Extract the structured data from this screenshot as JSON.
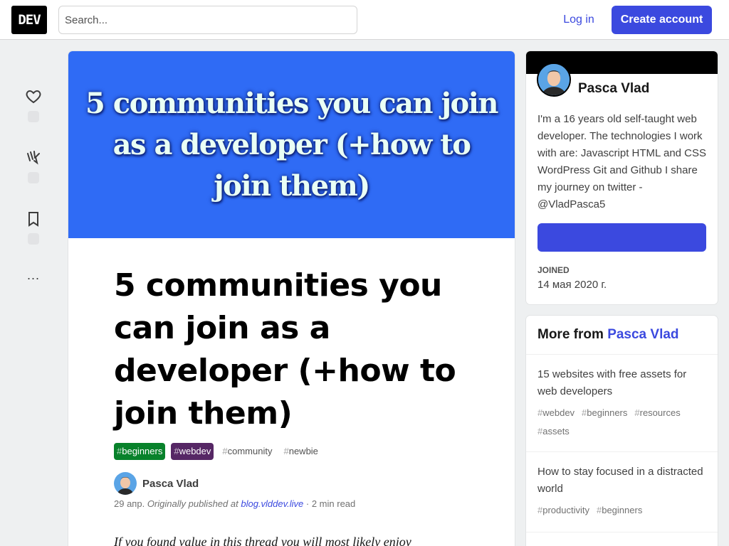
{
  "header": {
    "logo": "DEV",
    "search_placeholder": "Search...",
    "login_label": "Log in",
    "create_account_label": "Create account"
  },
  "actions": {
    "heart_icon": "heart-icon",
    "unicorn_icon": "unicorn-icon",
    "bookmark_icon": "bookmark-icon",
    "more_label": "..."
  },
  "article": {
    "cover_text": "5 communities you can join as a developer (+how to join them)",
    "title": "5 communities you can join as a developer (+how to join them)",
    "tags": [
      {
        "hash": "#",
        "name": "beginners",
        "style": "green"
      },
      {
        "hash": "#",
        "name": "webdev",
        "style": "purple"
      },
      {
        "hash": "#",
        "name": "community",
        "style": "plain"
      },
      {
        "hash": "#",
        "name": "newbie",
        "style": "plain"
      }
    ],
    "author_name": "Pasca Vlad",
    "date": "29 апр.",
    "originally_published": "Originally published at",
    "published_link": "blog.vlddev.live",
    "read_time": "2 min read",
    "body_start": "If you found value in this thread you will most likely enjoy"
  },
  "profile": {
    "name": "Pasca Vlad",
    "bio": "I'm a 16 years old self-taught web developer. The technologies I work with are: Javascript HTML and CSS WordPress Git and Github I share my journey on twitter - @VladPasca5",
    "joined_label": "JOINED",
    "joined_value": "14 мая 2020 г."
  },
  "more_from": {
    "prefix": "More from",
    "author": "Pasca Vlad",
    "items": [
      {
        "title": "15 websites with free assets for web developers",
        "tags": [
          "webdev",
          "beginners",
          "resources",
          "assets"
        ]
      },
      {
        "title": "How to stay focused in a distracted world",
        "tags": [
          "productivity",
          "beginners"
        ]
      }
    ]
  },
  "colors": {
    "accent": "#3b49df",
    "cover_bg": "#2f6bf5",
    "tag_green": "#08822b",
    "tag_purple": "#562765"
  }
}
